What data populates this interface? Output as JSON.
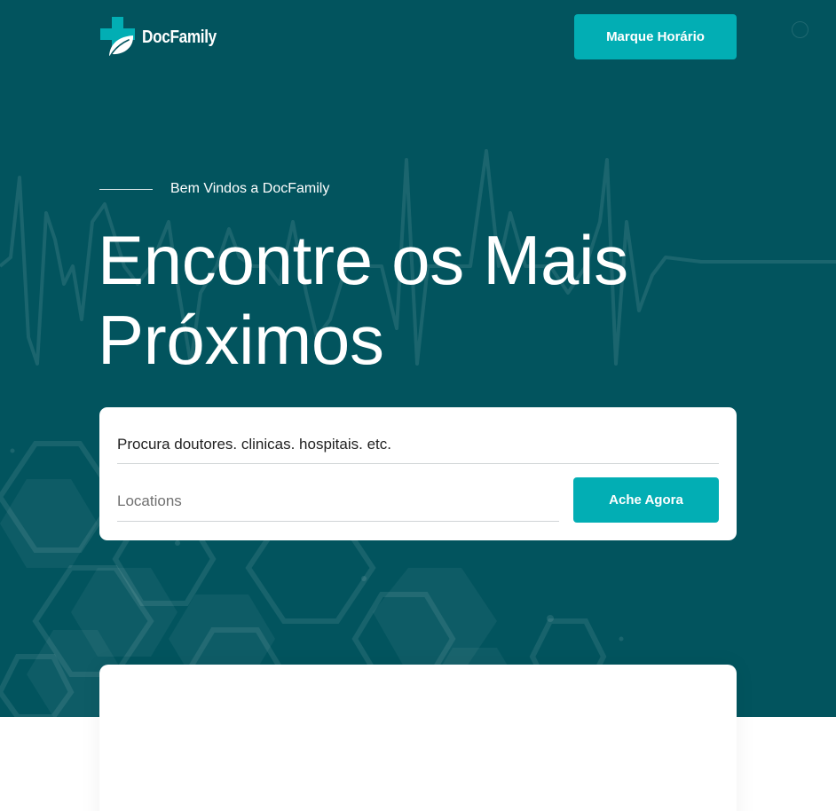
{
  "header": {
    "brand": "DocFamily",
    "cta_label": "Marque Horário"
  },
  "hero": {
    "welcome": "Bem Vindos a DocFamily",
    "headline_line1": "Encontre os Mais",
    "headline_line2": "Próximos"
  },
  "search": {
    "query_placeholder": "Procura doutores. clinicas. hospitais. etc.",
    "location_placeholder": "Locations",
    "submit_label": "Ache Agora"
  },
  "colors": {
    "hero_background": "#02545e",
    "accent": "#02aeb4",
    "card": "#ffffff"
  },
  "icons": [
    "medical-cross-leaf-logo-icon"
  ]
}
